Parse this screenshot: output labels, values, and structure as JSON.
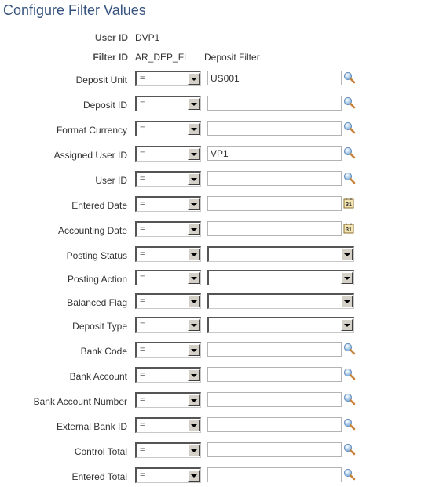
{
  "page": {
    "title": "Configure Filter Values"
  },
  "header": {
    "user_id_label": "User ID",
    "user_id_value": "DVP1",
    "filter_id_label": "Filter ID",
    "filter_id_value": "AR_DEP_FL",
    "filter_description": "Deposit Filter"
  },
  "fields": [
    {
      "label": "Deposit Unit",
      "operator": "=",
      "type": "lookup",
      "value": "US001",
      "icon": "lookup-icon"
    },
    {
      "label": "Deposit ID",
      "operator": "=",
      "type": "lookup",
      "value": "",
      "icon": "lookup-icon"
    },
    {
      "label": "Format Currency",
      "operator": "=",
      "type": "lookup",
      "value": "",
      "icon": "lookup-icon"
    },
    {
      "label": "Assigned User ID",
      "operator": "=",
      "type": "lookup",
      "value": "VP1",
      "icon": "lookup-icon"
    },
    {
      "label": "User ID",
      "operator": "=",
      "type": "lookup",
      "value": "",
      "icon": "lookup-icon"
    },
    {
      "label": "Entered Date",
      "operator": "=",
      "type": "date",
      "value": "",
      "icon": "calendar-icon"
    },
    {
      "label": "Accounting Date",
      "operator": "=",
      "type": "date",
      "value": "",
      "icon": "calendar-icon"
    },
    {
      "label": "Posting Status",
      "operator": "=",
      "type": "select",
      "value": ""
    },
    {
      "label": "Posting Action",
      "operator": "=",
      "type": "select",
      "value": ""
    },
    {
      "label": "Balanced Flag",
      "operator": "=",
      "type": "select",
      "value": ""
    },
    {
      "label": "Deposit Type",
      "operator": "=",
      "type": "select",
      "value": ""
    },
    {
      "label": "Bank Code",
      "operator": "=",
      "type": "lookup",
      "value": "",
      "icon": "lookup-icon"
    },
    {
      "label": "Bank Account",
      "operator": "=",
      "type": "lookup",
      "value": "",
      "icon": "lookup-icon"
    },
    {
      "label": "Bank Account Number",
      "operator": "=",
      "type": "lookup",
      "value": "",
      "icon": "lookup-icon"
    },
    {
      "label": "External Bank ID",
      "operator": "=",
      "type": "lookup",
      "value": "",
      "icon": "lookup-icon"
    },
    {
      "label": "Control Total",
      "operator": "=",
      "type": "lookup",
      "value": "",
      "icon": "lookup-icon"
    },
    {
      "label": "Entered Total",
      "operator": "=",
      "type": "lookup",
      "value": "",
      "icon": "lookup-icon"
    }
  ]
}
